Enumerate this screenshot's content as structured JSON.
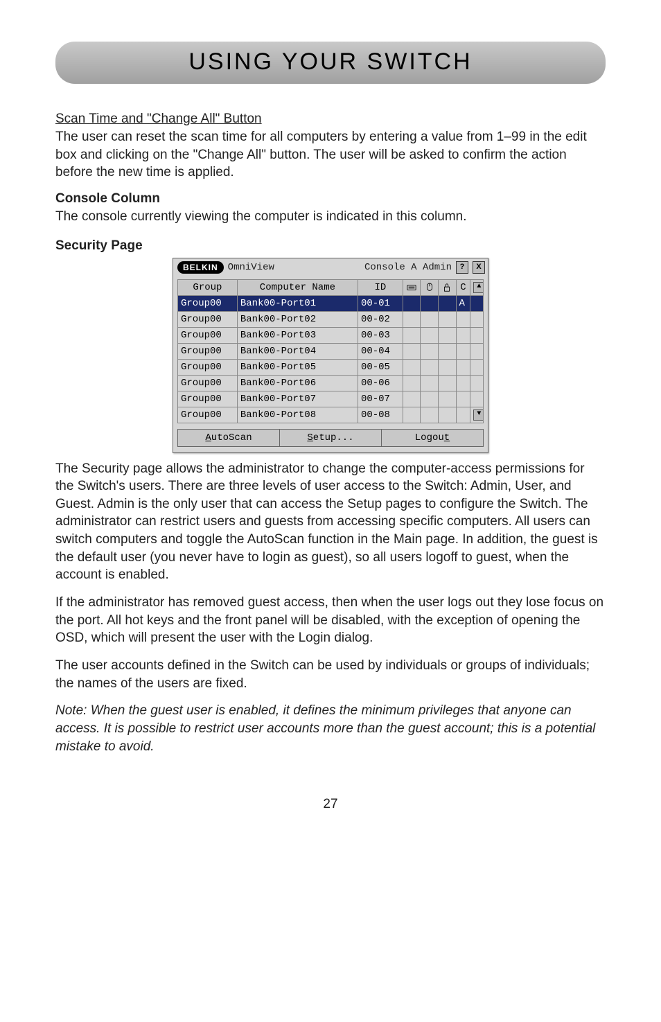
{
  "title": "USING YOUR SWITCH",
  "scan_heading": "Scan Time and \"Change All\" Button",
  "scan_body": "The user can reset the scan time for all computers by entering a value from 1–99 in the edit box and clicking on the \"Change All\" button. The user will be asked to confirm the action before the new time is applied.",
  "console_heading": "Console Column",
  "console_body": "The console currently viewing the computer is indicated in this column.",
  "security_heading": "Security Page",
  "osd": {
    "brand": "BELKIN",
    "app": "OmniView",
    "console": "Console A Admin",
    "help_btn": "?",
    "close_btn": "X",
    "cols": {
      "group": "Group",
      "name": "Computer Name",
      "id": "ID",
      "c": "C"
    },
    "rows": [
      {
        "group": "Group00",
        "name": "Bank00-Port01",
        "id": "00-01",
        "c": "A",
        "selected": true
      },
      {
        "group": "Group00",
        "name": "Bank00-Port02",
        "id": "00-02",
        "c": "",
        "selected": false
      },
      {
        "group": "Group00",
        "name": "Bank00-Port03",
        "id": "00-03",
        "c": "",
        "selected": false
      },
      {
        "group": "Group00",
        "name": "Bank00-Port04",
        "id": "00-04",
        "c": "",
        "selected": false
      },
      {
        "group": "Group00",
        "name": "Bank00-Port05",
        "id": "00-05",
        "c": "",
        "selected": false
      },
      {
        "group": "Group00",
        "name": "Bank00-Port06",
        "id": "00-06",
        "c": "",
        "selected": false
      },
      {
        "group": "Group00",
        "name": "Bank00-Port07",
        "id": "00-07",
        "c": "",
        "selected": false
      },
      {
        "group": "Group00",
        "name": "Bank00-Port08",
        "id": "00-08",
        "c": "",
        "selected": false
      }
    ],
    "buttons": {
      "autoscan_pre": "A",
      "autoscan_rest": "utoScan",
      "setup_pre": "S",
      "setup_rest": "etup...",
      "logout_pre": "Logou",
      "logout_rest": "t"
    }
  },
  "para_security": "The Security page allows the administrator to change the computer-access permissions for the Switch's users. There are three levels of user access to the Switch: Admin, User, and Guest. Admin is the only user that can access the Setup pages to configure the Switch. The administrator can restrict users and guests from accessing specific computers. All users can switch computers and toggle the AutoScan function in the Main page. In addition, the guest is the default user (you never have to login as guest), so all users logoff to guest, when the account is enabled.",
  "para_guest_removed": "If the administrator has removed guest access, then when the user logs out they lose focus on the port. All hot keys and the front panel will be disabled, with the exception of opening the OSD, which will present the user with the Login dialog.",
  "para_accounts": "The user accounts defined in the Switch can be used by individuals or groups of individuals; the names of the users are fixed.",
  "para_note": "Note: When the guest user is enabled, it defines the minimum privileges that anyone can access. It is possible to restrict user accounts more than the guest account; this is a potential mistake to avoid.",
  "page_number": "27"
}
